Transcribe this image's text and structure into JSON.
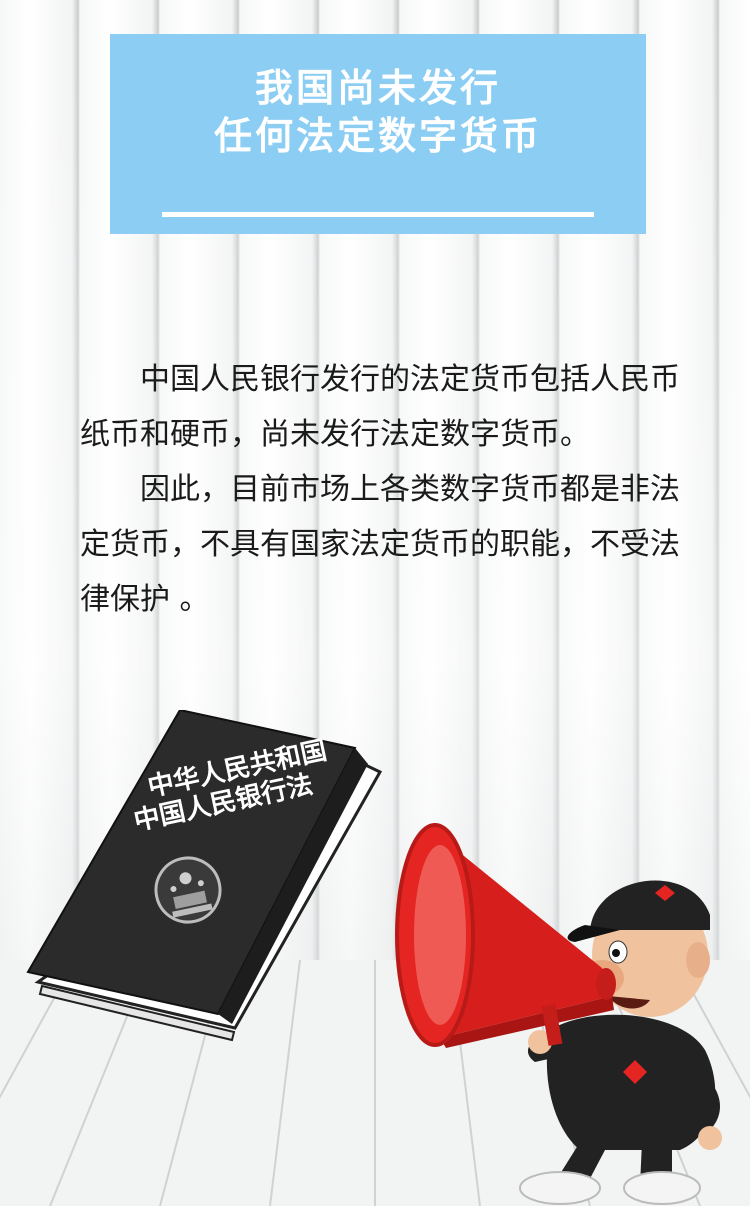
{
  "title": {
    "line1": "我国尚未发行",
    "line2": "任何法定数字货币"
  },
  "body": {
    "paragraph1": "中国人民银行发行的法定货币包括人民币纸币和硬币，尚未发行法定数字货币。",
    "paragraph2": "因此，目前市场上各类数字货币都是非法定货币，不具有国家法定货币的职能，不受法律保护 。"
  },
  "book": {
    "title_line1": "中华人民共和国",
    "title_line2": "中国人民银行法",
    "icon": "national-emblem-icon"
  },
  "mascot": {
    "icon": "megaphone-icon"
  },
  "colors": {
    "title_bg": "#8ccdf3",
    "book_cover": "#2b2b2b",
    "megaphone": "#e52521"
  }
}
